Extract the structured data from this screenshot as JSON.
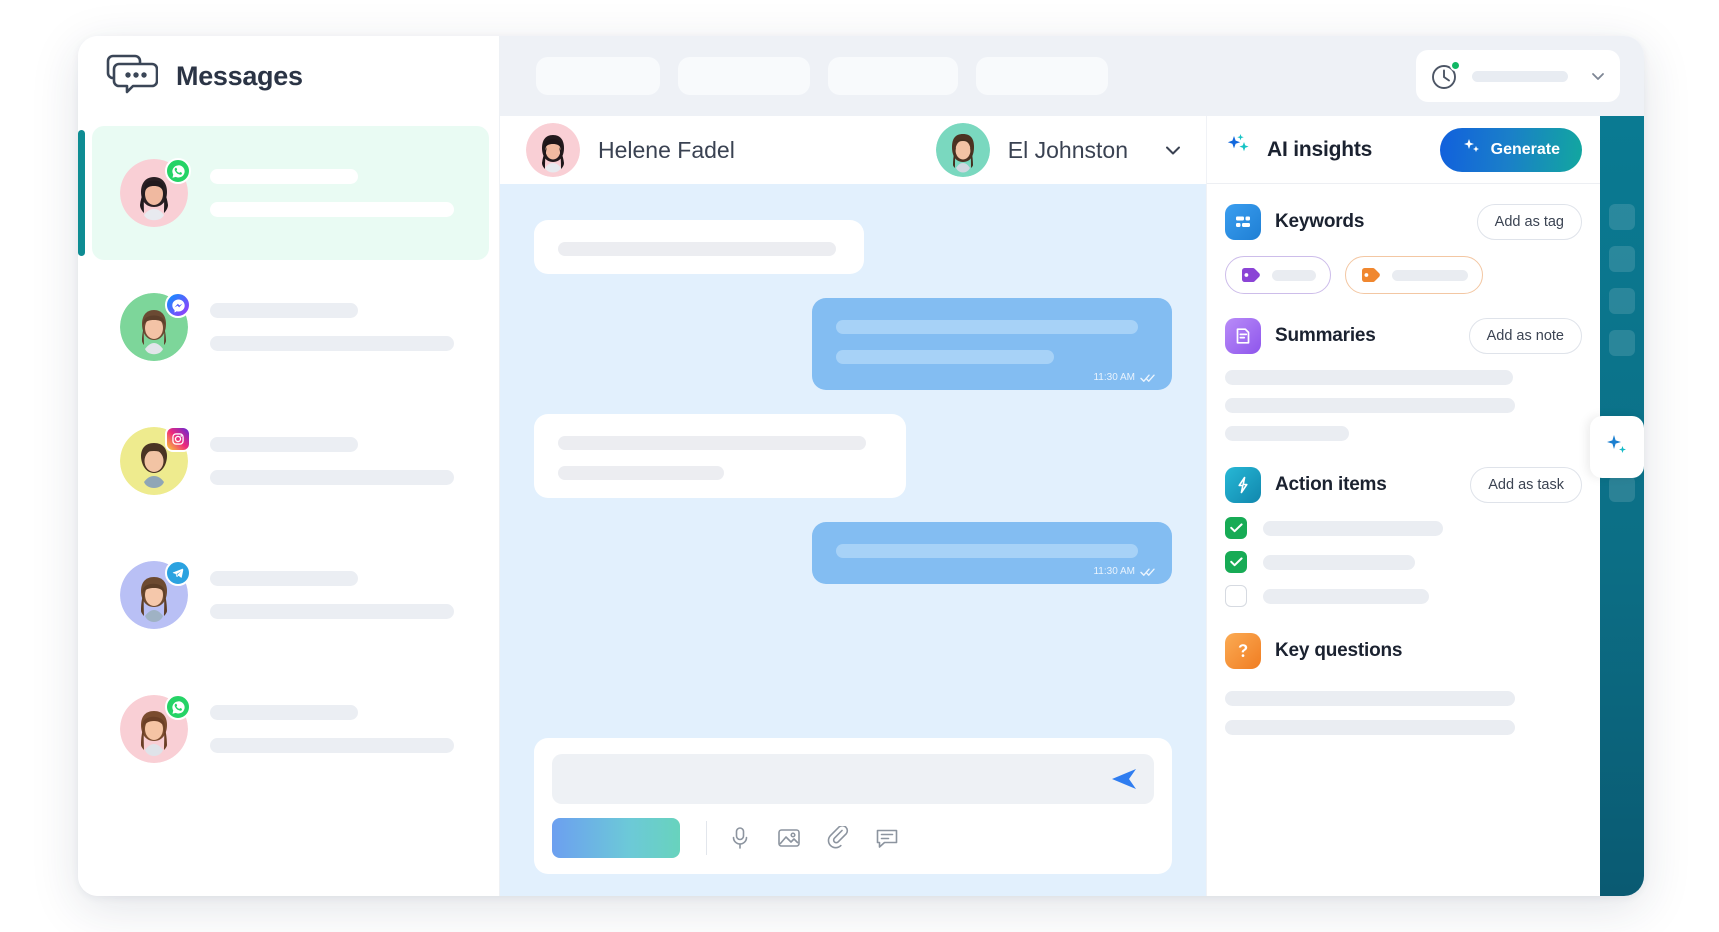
{
  "brand": {
    "title": "Messages",
    "icon": "chat-bubbles-icon"
  },
  "topbar": {
    "nav_placeholders": [
      "",
      "",
      "",
      ""
    ],
    "status": {
      "icon": "clock-icon",
      "dot_color": "#11b764",
      "value": "",
      "chevron": "chevron-down-icon"
    }
  },
  "conversations": [
    {
      "platform": "whatsapp",
      "ring_color": "#f9cfd5",
      "active": true,
      "line1": "",
      "line2": ""
    },
    {
      "platform": "messenger",
      "ring_color": "#7dd69a",
      "active": false,
      "line1": "",
      "line2": ""
    },
    {
      "platform": "instagram",
      "ring_color": "#eeeb8e",
      "active": false,
      "line1": "",
      "line2": ""
    },
    {
      "platform": "telegram",
      "ring_color": "#b9c0f5",
      "active": false,
      "line1": "",
      "line2": ""
    },
    {
      "platform": "whatsapp",
      "ring_color": "#f9cfd5",
      "active": false,
      "line1": "",
      "line2": ""
    }
  ],
  "chat": {
    "contact_name": "Helene Fadel",
    "agent_name": "El Johnston",
    "agent_chevron": "chevron-down-icon",
    "messages": [
      {
        "direction": "in",
        "lines": [
          1
        ],
        "time": ""
      },
      {
        "direction": "out",
        "lines": [
          2
        ],
        "time": "11:30 AM",
        "status": "read"
      },
      {
        "direction": "in",
        "lines": [
          2
        ],
        "time": ""
      },
      {
        "direction": "out",
        "lines": [
          1
        ],
        "time": "11:30 AM",
        "status": "read"
      }
    ],
    "composer": {
      "placeholder": "",
      "send_icon": "send-icon",
      "primary_button_label": "",
      "tools": [
        "microphone-icon",
        "image-icon",
        "attachment-icon",
        "template-icon"
      ]
    }
  },
  "insights": {
    "title": "AI insights",
    "title_icon": "sparkles-icon",
    "generate_label": "Generate",
    "sections": [
      {
        "id": "keywords",
        "title": "Keywords",
        "icon": "keywords-icon",
        "icon_color": "#2e8ce5",
        "action_label": "Add as tag",
        "tags": [
          {
            "color": "#8b44d6",
            "label": ""
          },
          {
            "color": "#f0872f",
            "label": ""
          }
        ]
      },
      {
        "id": "summaries",
        "title": "Summaries",
        "icon": "document-icon",
        "icon_color": "#a06bf2",
        "action_label": "Add as note",
        "lines": [
          262,
          264,
          112
        ]
      },
      {
        "id": "action-items",
        "title": "Action items",
        "icon": "lightning-icon",
        "icon_color": "#18a2bd",
        "action_label": "Add as task",
        "items": [
          {
            "checked": true,
            "label": ""
          },
          {
            "checked": true,
            "label": ""
          },
          {
            "checked": false,
            "label": ""
          }
        ]
      },
      {
        "id": "key-questions",
        "title": "Key questions",
        "icon": "question-icon",
        "icon_color": "#f5903a",
        "action_label": "",
        "lines": [
          262,
          262
        ]
      }
    ]
  },
  "rail": {
    "tab_icon": "sparkle-icon",
    "squares": 6
  }
}
